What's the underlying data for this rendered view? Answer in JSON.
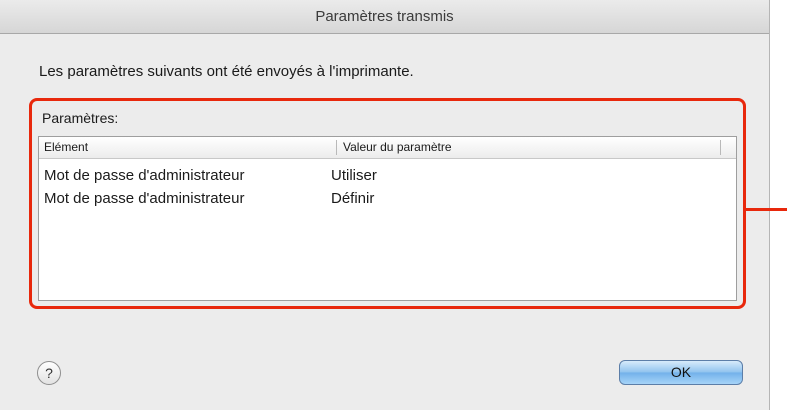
{
  "window": {
    "title": "Paramètres transmis"
  },
  "message": "Les paramètres suivants ont été envoyés à l'imprimante.",
  "group_label": "Paramètres:",
  "table": {
    "columns": [
      "Elément",
      "Valeur du paramètre"
    ],
    "rows": [
      [
        "Mot de passe d'administrateur",
        "Utiliser"
      ],
      [
        "Mot de passe d'administrateur",
        "Définir"
      ]
    ]
  },
  "buttons": {
    "help_label": "?",
    "ok_label": "OK"
  },
  "colors": {
    "highlight": "#e8280c",
    "ok_button": "#72b1ea"
  },
  "icons": {
    "help": "help-question-icon"
  }
}
